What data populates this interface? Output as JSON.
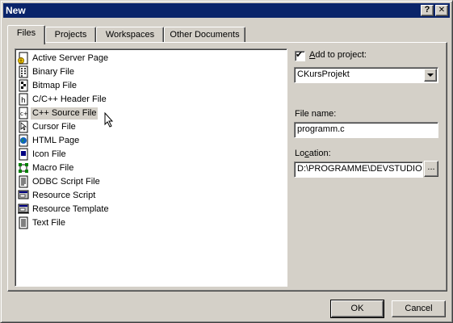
{
  "window": {
    "title": "New",
    "help_glyph": "?",
    "close_glyph": "✕"
  },
  "tabs": [
    {
      "label": "Files",
      "active": true
    },
    {
      "label": "Projects",
      "active": false
    },
    {
      "label": "Workspaces",
      "active": false
    },
    {
      "label": "Other Documents",
      "active": false
    }
  ],
  "file_types": [
    {
      "label": "Active Server Page",
      "icon": "asp-file-icon"
    },
    {
      "label": "Binary File",
      "icon": "binary-file-icon"
    },
    {
      "label": "Bitmap File",
      "icon": "bitmap-file-icon"
    },
    {
      "label": "C/C++ Header File",
      "icon": "header-file-icon"
    },
    {
      "label": "C++ Source File",
      "icon": "cpp-source-file-icon",
      "selected": true
    },
    {
      "label": "Cursor File",
      "icon": "cursor-file-icon"
    },
    {
      "label": "HTML Page",
      "icon": "html-page-icon"
    },
    {
      "label": "Icon File",
      "icon": "icon-file-icon"
    },
    {
      "label": "Macro File",
      "icon": "macro-file-icon"
    },
    {
      "label": "ODBC Script File",
      "icon": "odbc-script-file-icon"
    },
    {
      "label": "Resource Script",
      "icon": "resource-script-icon"
    },
    {
      "label": "Resource Template",
      "icon": "resource-template-icon"
    },
    {
      "label": "Text File",
      "icon": "text-file-icon"
    }
  ],
  "add_to_project": {
    "label_prefix": "",
    "label_access": "A",
    "label_rest": "dd to project:",
    "checked": true,
    "checkmark": "✔",
    "value": "CKursProjekt"
  },
  "file_name": {
    "label": "File name:",
    "value": "programm.c"
  },
  "location": {
    "label_access": "Lo",
    "label_underline": "c",
    "label_rest": "ation:",
    "value": "D:\\PROGRAMME\\DEVSTUDIO",
    "browse_label": "..."
  },
  "buttons": {
    "ok": "OK",
    "cancel": "Cancel"
  }
}
